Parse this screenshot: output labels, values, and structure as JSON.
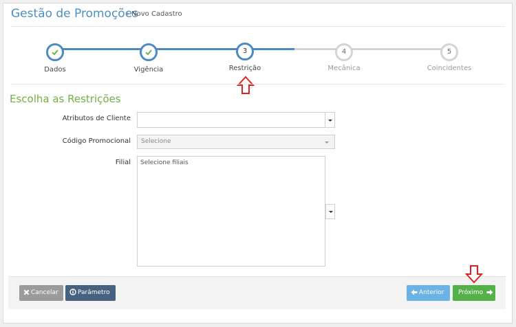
{
  "header": {
    "title": "Gestão de Promoções",
    "breadcrumb_sep": "»",
    "breadcrumb": "Novo Cadastro"
  },
  "stepper": {
    "steps": [
      {
        "number": "1",
        "label": "Dados",
        "state": "complete"
      },
      {
        "number": "2",
        "label": "Vigência",
        "state": "complete"
      },
      {
        "number": "3",
        "label": "Restrição",
        "state": "active"
      },
      {
        "number": "4",
        "label": "Mecânica",
        "state": "pending"
      },
      {
        "number": "5",
        "label": "Coincidentes",
        "state": "pending"
      }
    ]
  },
  "section": {
    "title": "Escolha as Restrições"
  },
  "form": {
    "atributos_label": "Atributos de Cliente",
    "atributos_value": "",
    "codigo_label": "Código Promocional",
    "codigo_value": "Selecione",
    "filial_label": "Filial",
    "filial_placeholder": "Selecione filiais"
  },
  "footer": {
    "cancel_label": "Cancelar",
    "param_label": "Parâmetro",
    "prev_label": "Anterior",
    "next_label": "Próximo"
  },
  "colors": {
    "accent_blue": "#4a8ac2",
    "success_green": "#55b04a",
    "section_green": "#72b043",
    "arrow_red": "#e02020"
  },
  "icons": [
    "check-icon",
    "arrow-up-outline-icon",
    "arrow-down-outline-icon",
    "times-icon",
    "info-circle-icon",
    "arrow-left-icon",
    "arrow-right-icon",
    "caret-down-icon"
  ]
}
